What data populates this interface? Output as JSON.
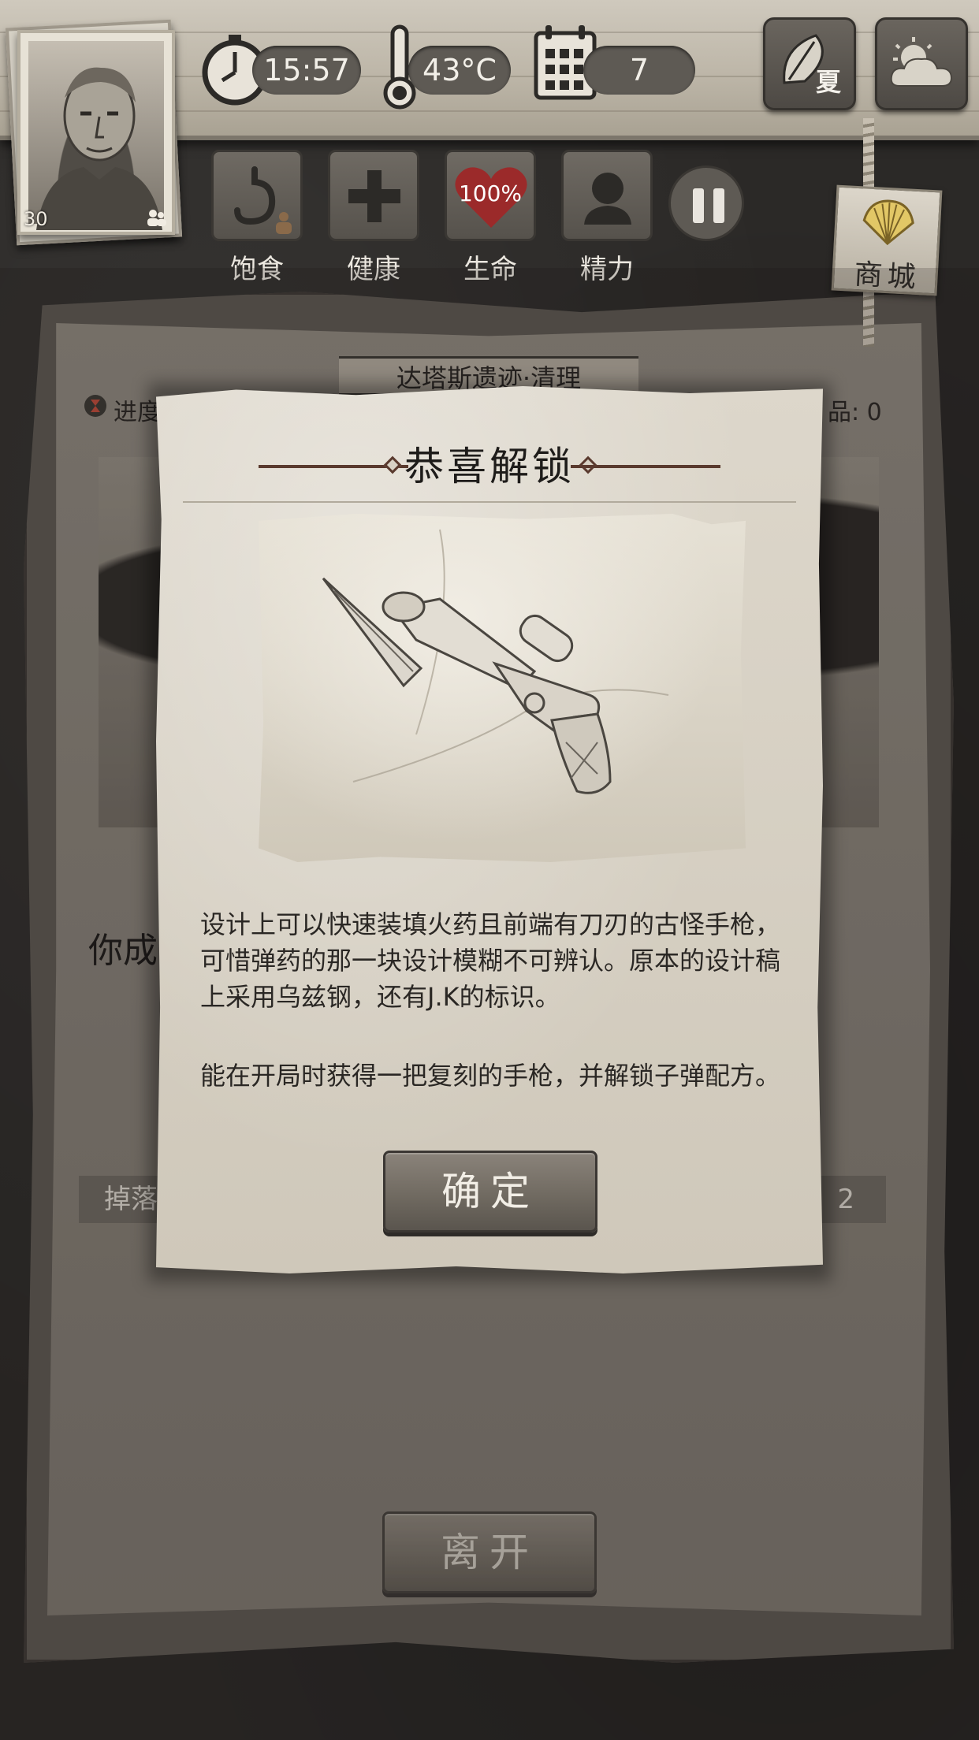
{
  "hud": {
    "portrait_level": "30",
    "time": "15:57",
    "temperature": "43°C",
    "day": "7",
    "season": "夏"
  },
  "status": {
    "hunger_label": "饱食",
    "health_label": "健康",
    "life_label": "生命",
    "life_value": "100%",
    "energy_label": "精力"
  },
  "shop": {
    "label": "商城"
  },
  "background": {
    "region_title": "达塔斯遗迹·清理",
    "progress_label": "进度",
    "items_label": "品: 0",
    "result_text": "你成",
    "drop_label": "掉落",
    "drop_count": "2",
    "leave_label": "离开"
  },
  "modal": {
    "title": "恭喜解锁",
    "description": "设计上可以快速装填火药且前端有刀刃的古怪手枪，可惜弹药的那一块设计模糊不可辨认。原本的设计稿上采用乌兹钢，还有J.K的标识。",
    "effect": "能在开局时获得一把复刻的手枪，并解锁子弹配方。",
    "confirm_label": "确定"
  },
  "colors": {
    "paper": "#d8d2c5",
    "heart": "#9b2a2a",
    "accent_rule": "#5a3a2e"
  },
  "icons": {
    "clock": "stopwatch-icon",
    "thermometer": "thermometer-icon",
    "calendar": "calendar-icon",
    "season": "leaf-icon",
    "weather": "partly-cloudy-icon",
    "hunger": "stomach-icon",
    "health": "cross-icon",
    "life": "heart-icon",
    "energy": "head-icon",
    "pause": "pause-icon",
    "shop": "shell-icon"
  }
}
